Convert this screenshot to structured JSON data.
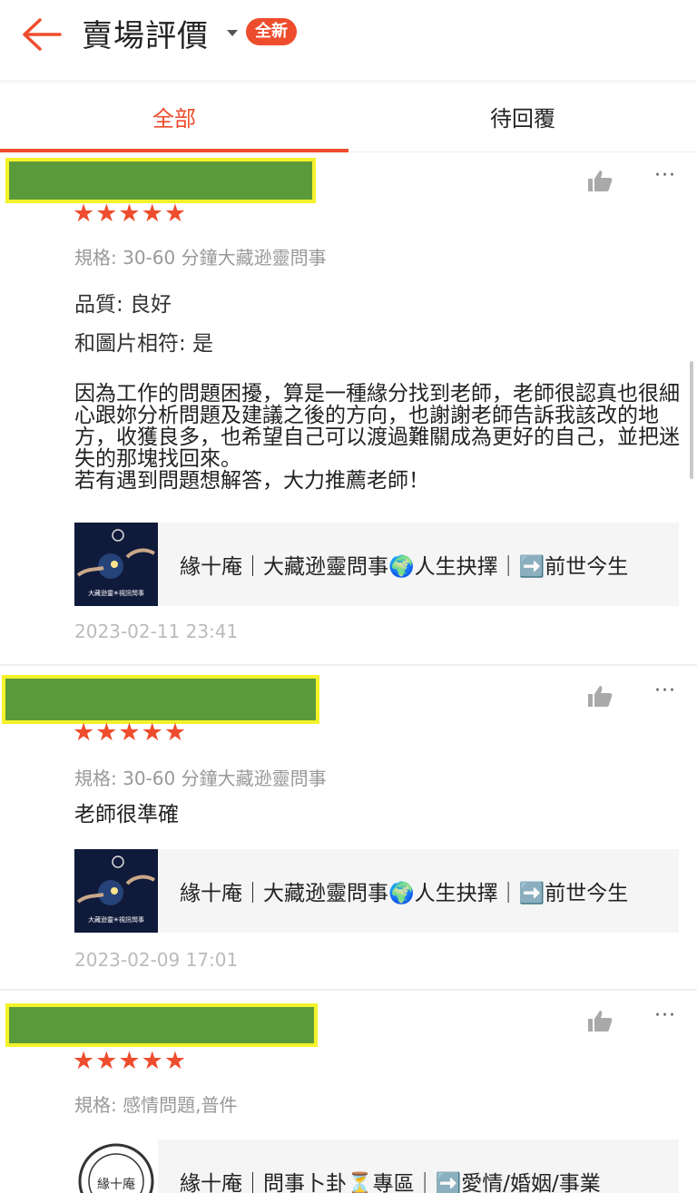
{
  "header": {
    "title": "賣場評價",
    "badge": "全新"
  },
  "tabs": [
    {
      "label": "全部",
      "active": true
    },
    {
      "label": "待回覆",
      "active": false
    }
  ],
  "accent_color": "#ee4d2d",
  "reviews": [
    {
      "stars": "★★★★★",
      "variant": "規格: 30-60 分鐘大藏逊靈問事",
      "attributes": [
        "品質: 良好",
        "和圖片相符: 是"
      ],
      "comment": "因為工作的問題困擾，算是一種緣分找到老師，老師很認真也很細心跟妳分析問題及建議之後的方向，也謝謝老師告訴我該改的地方，收獲良多，也希望自己可以渡過難關成為更好的自己，並把迷失的那塊找回來。\n若有遇到問題想解答，大力推薦老師！",
      "product_title": "緣十庵｜大藏逊靈問事🌍人生抉擇｜➡️前世今生",
      "thumb_caption": "大藏逊靈✳視訊問事",
      "date": "2023-02-11 23:41"
    },
    {
      "stars": "★★★★★",
      "variant": "規格: 30-60 分鐘大藏逊靈問事",
      "comment": "老師很準確",
      "product_title": "緣十庵｜大藏逊靈問事🌍人生抉擇｜➡️前世今生",
      "thumb_caption": "大藏逊靈✳視訊問事",
      "date": "2023-02-09 17:01"
    },
    {
      "stars": "★★★★★",
      "variant": "規格: 感情問題,普件",
      "product_title": "緣十庵｜問事卜卦⏳專區｜➡️愛情/婚姻/事業",
      "thumb_caption": "緣十庵"
    }
  ]
}
